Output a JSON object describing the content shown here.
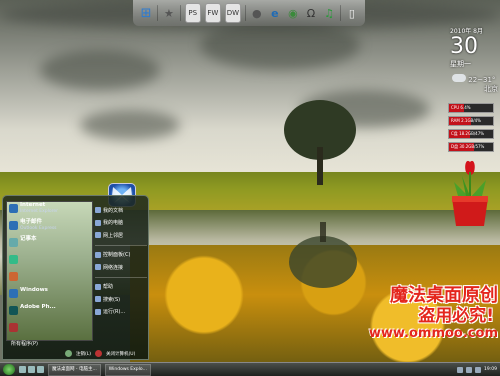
{
  "dock": {
    "items": [
      {
        "name": "windows-flag-icon",
        "glyph": "⊞"
      },
      {
        "name": "star-icon",
        "glyph": "★"
      },
      {
        "name": "photoshop-icon",
        "label": "PS"
      },
      {
        "name": "fireworks-icon",
        "label": "FW"
      },
      {
        "name": "dreamweaver-icon",
        "label": "DW"
      },
      {
        "name": "chat-bubble-icon",
        "glyph": "●"
      },
      {
        "name": "ie-icon",
        "glyph": "e"
      },
      {
        "name": "rss-icon",
        "glyph": "◉"
      },
      {
        "name": "headphones-icon",
        "glyph": "Ω"
      },
      {
        "name": "music-icon",
        "glyph": "♫"
      },
      {
        "name": "recycle-bin-icon",
        "glyph": "▯"
      }
    ]
  },
  "clock": {
    "year_month": "2010年 8月",
    "day": "30",
    "weekday": "星期一"
  },
  "weather": {
    "temp": "22~31°",
    "city": "北京"
  },
  "meters": [
    {
      "label": "CPU 6.4%",
      "level": 0.35
    },
    {
      "label": "RAM 2.1GB/4%",
      "level": 0.5
    },
    {
      "label": "C盘 18.2GB/47%",
      "level": 0.47
    },
    {
      "label": "D盘 30.2GB/57%",
      "level": 0.57
    }
  ],
  "start_menu": {
    "pinned": [
      {
        "title": "Internet",
        "sub": "Internet Explorer"
      },
      {
        "title": "电子邮件",
        "sub": "Outlook Express"
      },
      {
        "title": "记事本",
        "sub": ""
      },
      {
        "title": "",
        "sub": ""
      },
      {
        "title": "",
        "sub": ""
      },
      {
        "title": "Windows",
        "sub": ""
      },
      {
        "title": "Adobe Ph...",
        "sub": ""
      },
      {
        "title": "",
        "sub": ""
      }
    ],
    "all_programs": "所有程序(P)",
    "right_items": [
      "我的文档",
      "我的电脑",
      "网上邻居",
      "控制面板(C)",
      "网络连接",
      "帮助",
      "搜索(S)",
      "运行(R)..."
    ],
    "logoff": "注销(L)",
    "shutdown": "关闭计算机(U)"
  },
  "watermark": {
    "line1": "魔法桌面原创",
    "line2": "盗用必究!",
    "line3": "www.ommoo.com"
  },
  "taskbar": {
    "buttons": [
      "魔法桌面网 - 电脑主...",
      "Windows Explo..."
    ],
    "tray_time": "19:09"
  }
}
